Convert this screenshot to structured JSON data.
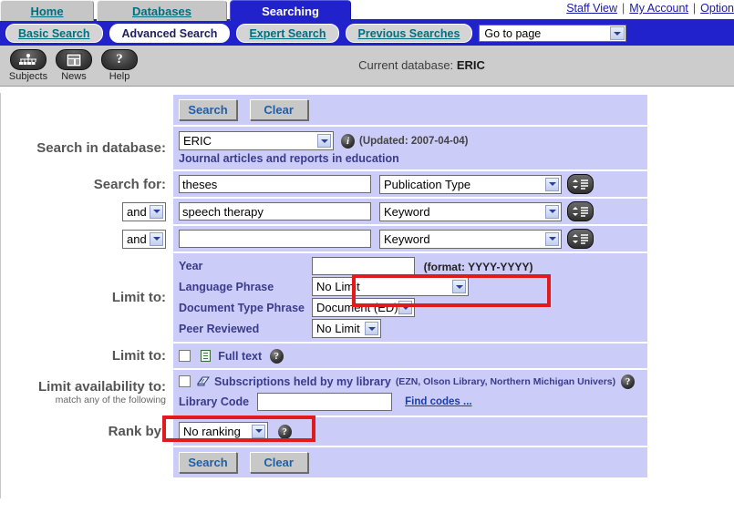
{
  "tabs": [
    {
      "label": "Home",
      "active": false
    },
    {
      "label": "Databases",
      "active": false
    },
    {
      "label": "Searching",
      "active": true
    }
  ],
  "top_links": [
    {
      "label": "Staff View"
    },
    {
      "label": "My Account"
    },
    {
      "label": "Option"
    }
  ],
  "nav": {
    "pills": [
      {
        "label": "Basic Search",
        "active": false
      },
      {
        "label": "Advanced Search",
        "active": true
      },
      {
        "label": "Expert Search",
        "active": false
      },
      {
        "label": "Previous Searches",
        "active": false
      }
    ],
    "goto_page": {
      "value": "Go to page"
    }
  },
  "toolbar": {
    "items": [
      {
        "label": "Subjects",
        "icon": "subjects-icon"
      },
      {
        "label": "News",
        "icon": "news-icon"
      },
      {
        "label": "Help",
        "icon": "help-icon"
      }
    ],
    "current_database_label": "Current database:",
    "current_database_value": "ERIC"
  },
  "actions": {
    "search_label": "Search",
    "clear_label": "Clear"
  },
  "database": {
    "row_label": "Search in database:",
    "selected": "ERIC",
    "updated": "(Updated: 2007-04-04)",
    "description": "Journal articles and reports in education",
    "info_icon": "info-icon"
  },
  "search_for": {
    "row_label": "Search for:",
    "rows": [
      {
        "operator": null,
        "term": "theses",
        "field": "Publication Type",
        "highlighted": true
      },
      {
        "operator": "and",
        "term": "speech therapy",
        "field": "Keyword",
        "highlighted": false
      },
      {
        "operator": "and",
        "term": "",
        "field": "Keyword",
        "highlighted": false
      }
    ]
  },
  "limits": {
    "row_label": "Limit to:",
    "year": {
      "label": "Year",
      "value": "",
      "format_hint": "(format: YYYY-YYYY)"
    },
    "language_phrase": {
      "label": "Language Phrase",
      "value": "No Limit"
    },
    "document_type_phrase": {
      "label": "Document Type Phrase",
      "value": "Document (ED)",
      "highlighted": true
    },
    "peer_reviewed": {
      "label": "Peer Reviewed",
      "value": "No Limit"
    }
  },
  "full_text": {
    "row_label": "Limit to:",
    "label": "Full text",
    "checked": false,
    "icon": "document-icon",
    "help_icon": "help-icon"
  },
  "availability": {
    "row_label": "Limit availability to:",
    "row_sublabel": "match any of the following",
    "subscriptions_label": "Subscriptions held by my library",
    "subscriptions_note": "(EZN, Olson Library, Northern Michigan Univers)",
    "checked": false,
    "icon": "library-icon",
    "help_icon": "help-icon",
    "library_code_label": "Library Code",
    "library_code_value": "",
    "find_codes_label": "Find codes ..."
  },
  "rank_by": {
    "row_label": "Rank by:",
    "value": "No ranking",
    "help_icon": "help-icon"
  },
  "colors": {
    "nav_blue": "#2222cc",
    "panel_lavender": "#ccccf8",
    "toolbar_gray": "#cccccc",
    "highlight_red": "#e01b1b",
    "link_teal": "#006f80",
    "label_gray": "#555555",
    "field_blue": "#3b3b8c"
  }
}
